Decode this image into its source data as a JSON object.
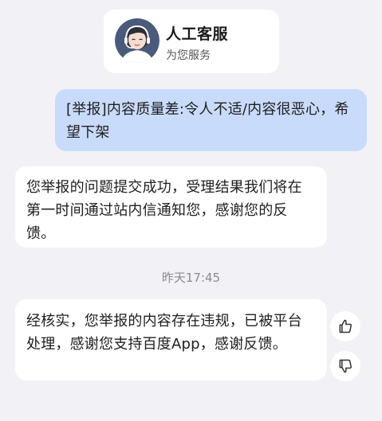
{
  "agent": {
    "name": "人工客服",
    "subtitle": "为您服务",
    "avatar_icon": "customer-service-agent-avatar"
  },
  "messages": [
    {
      "from": "user",
      "text": "[举报]内容质量差:令人不适/内容很恶心，希望下架"
    },
    {
      "from": "agent",
      "text": "您举报的问题提交成功，受理结果我们将在第一时间通过站内信通知您，感谢您的反馈。"
    },
    {
      "from": "agent",
      "text": "经核实，您举报的内容存在违规，已被平台处理，感谢您支持百度App，感谢反馈。"
    }
  ],
  "timestamp": "昨天17:45",
  "feedback": {
    "like_icon": "thumbs-up-icon",
    "dislike_icon": "thumbs-down-icon"
  },
  "colors": {
    "background": "#f2f2f6",
    "user_bubble": "#c9dbfa",
    "agent_bubble": "#ffffff",
    "avatar_bg": "#4a5a7a"
  }
}
